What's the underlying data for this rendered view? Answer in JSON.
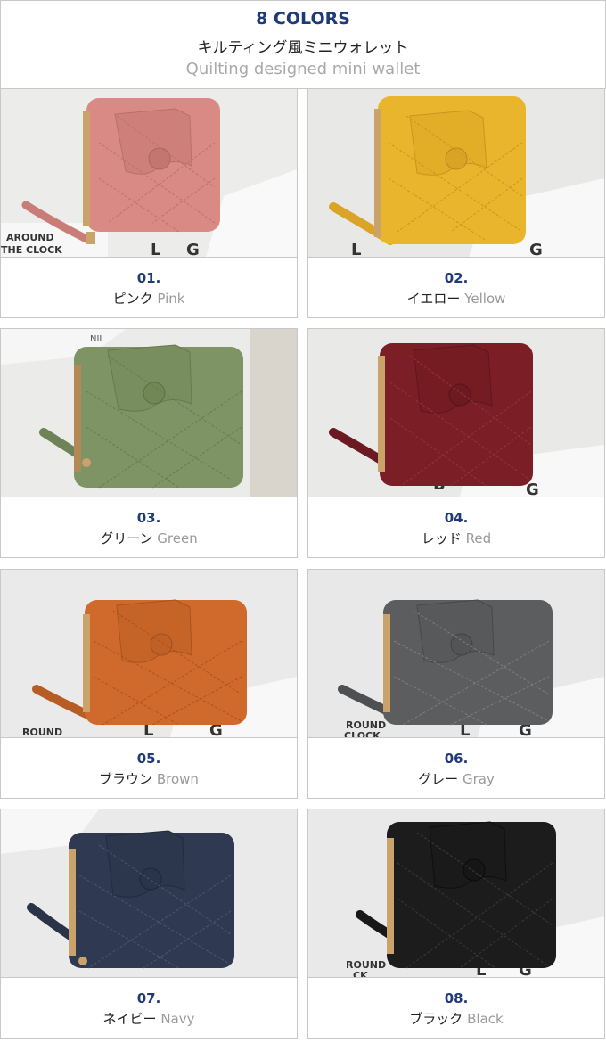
{
  "header": {
    "title": "8 COLORS",
    "subtitle_jp": "キルティング風ミニウォレット",
    "subtitle_en": "Quilting designed mini wallet"
  },
  "backdrop_texts": {
    "card1": [
      "AROUND",
      "THE CLOCK",
      "L",
      "G"
    ],
    "card2": [
      "L",
      "G"
    ],
    "card3": [
      "NIL"
    ],
    "card4": [
      "B",
      "G"
    ],
    "card5": [
      "ROUND",
      "L",
      "G"
    ],
    "card6": [
      "ROUND",
      "CLOCK",
      "L",
      "G"
    ],
    "card8": [
      "ROUND",
      "CK",
      "L",
      "G"
    ]
  },
  "items": [
    {
      "number": "01.",
      "name_jp": "ピンク",
      "name_en": "Pink",
      "color": "#d98a85"
    },
    {
      "number": "02.",
      "name_jp": "イエロー",
      "name_en": "Yellow",
      "color": "#e8b52c"
    },
    {
      "number": "03.",
      "name_jp": "グリーン",
      "name_en": "Green",
      "color": "#7f9465"
    },
    {
      "number": "04.",
      "name_jp": "レッド",
      "name_en": "Red",
      "color": "#7c1e25"
    },
    {
      "number": "05.",
      "name_jp": "ブラウン",
      "name_en": "Brown",
      "color": "#cf6a2c"
    },
    {
      "number": "06.",
      "name_jp": "グレー",
      "name_en": "Gray",
      "color": "#5b5d5f"
    },
    {
      "number": "07.",
      "name_jp": "ネイビー",
      "name_en": "Navy",
      "color": "#2f3a52"
    },
    {
      "number": "08.",
      "name_jp": "ブラック",
      "name_en": "Black",
      "color": "#1c1c1c"
    }
  ]
}
